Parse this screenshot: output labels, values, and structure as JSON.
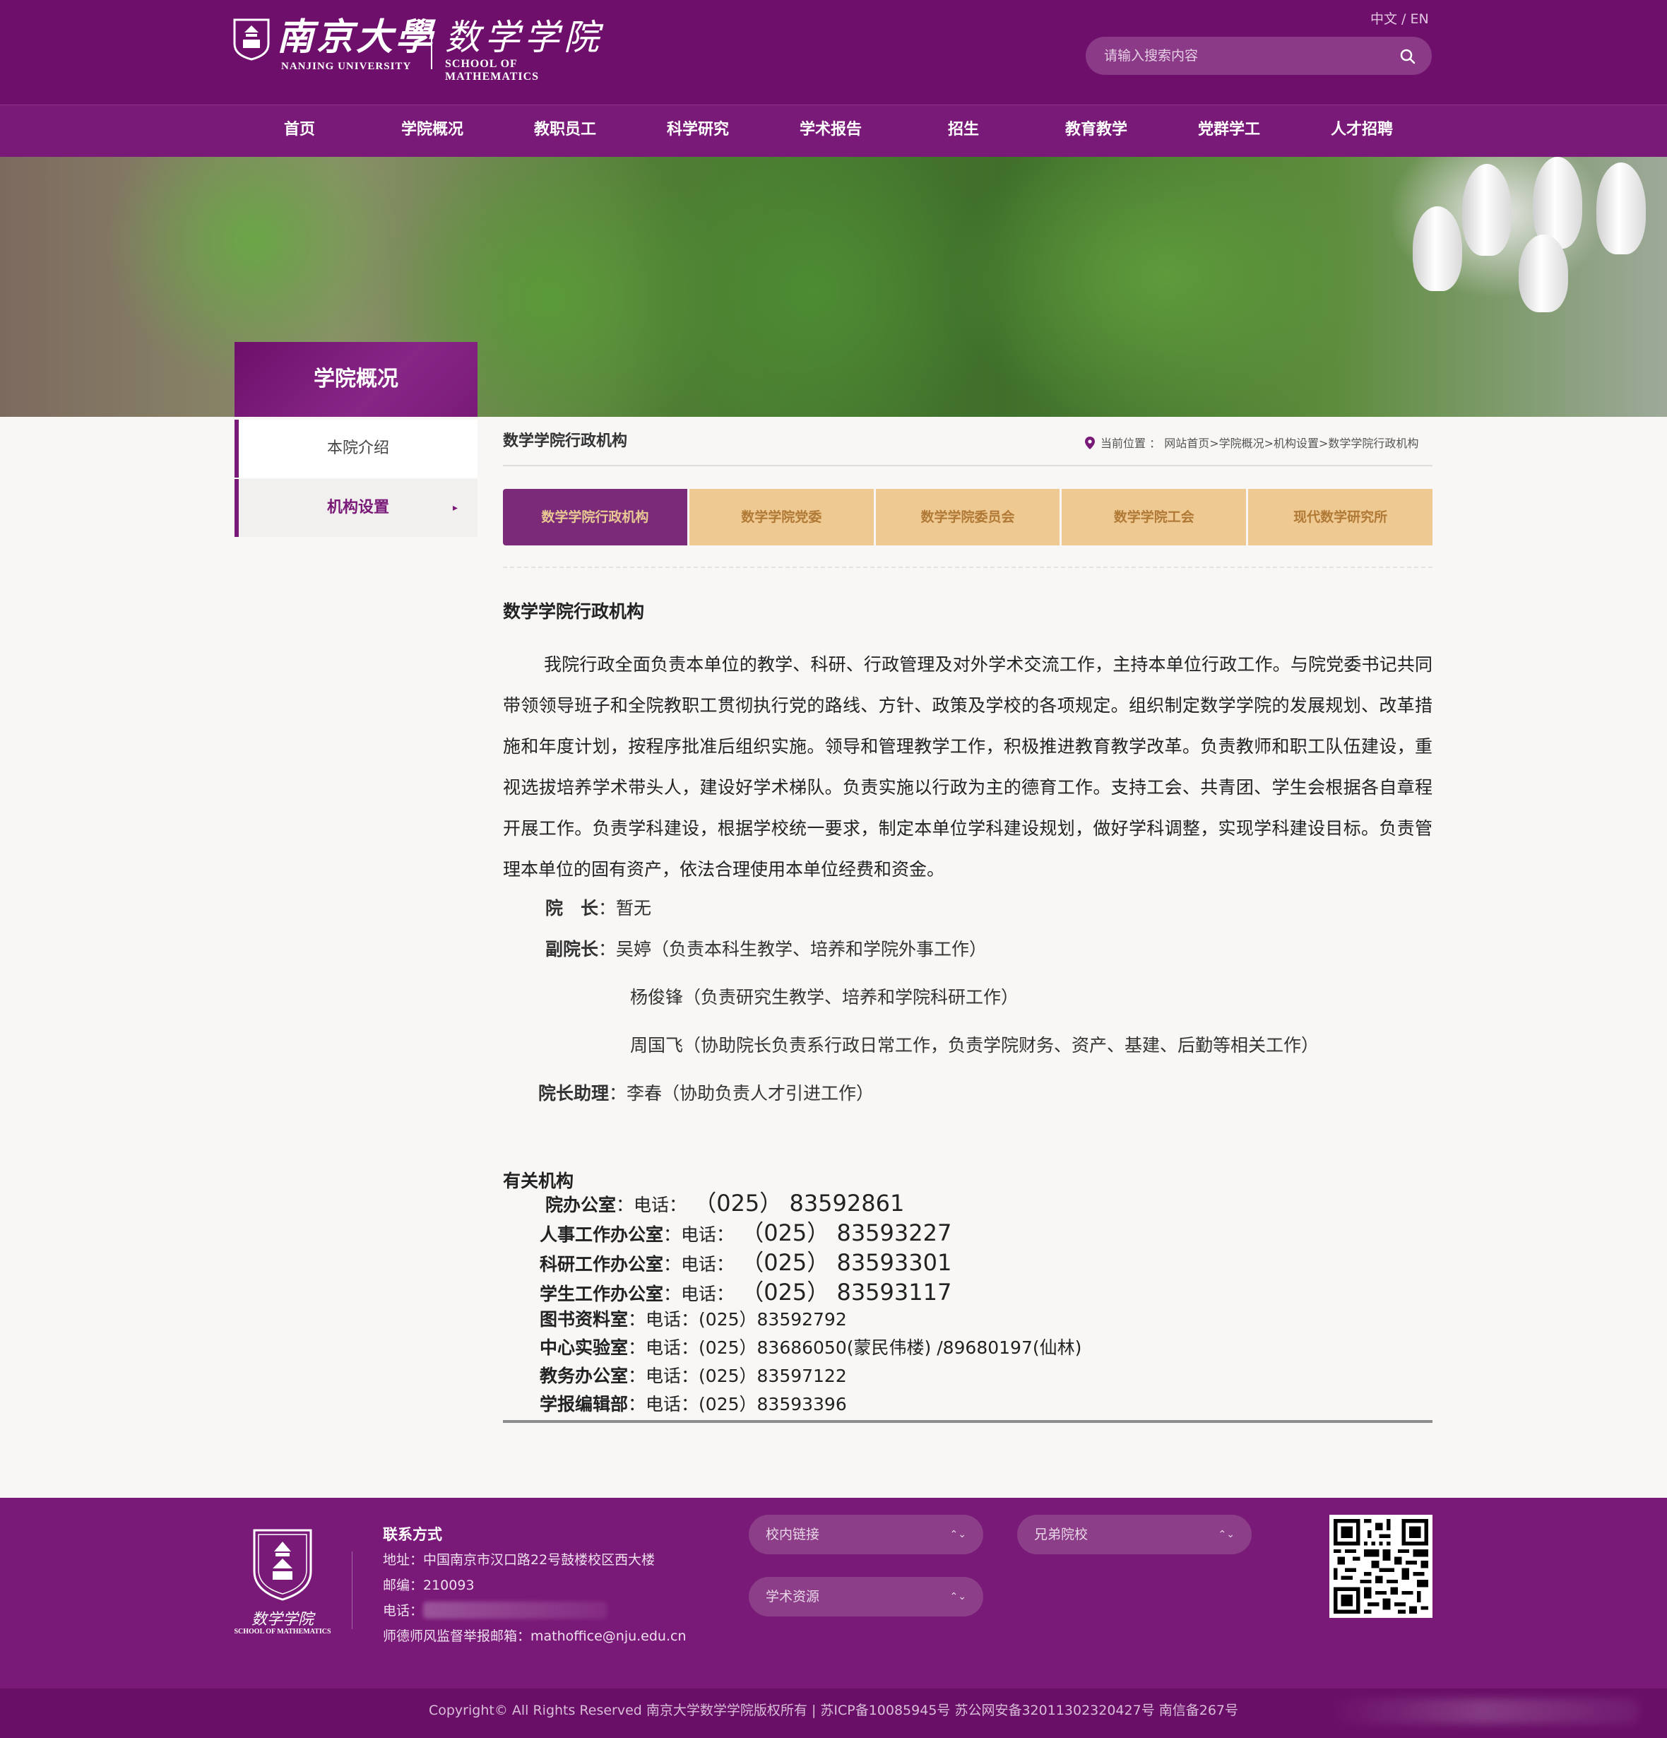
{
  "header": {
    "logo": {
      "nju_cn": "南京大學",
      "nju_en": "NANJING UNIVERSITY",
      "school_cn": "数学学院",
      "school_en": "SCHOOL OF MATHEMATICS"
    },
    "lang": {
      "cn": "中文",
      "sep": " / ",
      "en": "EN"
    },
    "search": {
      "placeholder": "请输入搜索内容",
      "icon": "search-icon"
    }
  },
  "nav": [
    "首页",
    "学院概况",
    "教职员工",
    "科学研究",
    "学术报告",
    "招生",
    "教育教学",
    "党群学工",
    "人才招聘"
  ],
  "sidebar": {
    "title": "学院概况",
    "items": [
      {
        "label": "本院介绍"
      },
      {
        "label": "机构设置",
        "arrow": "▸"
      }
    ]
  },
  "main": {
    "title": "数学学院行政机构",
    "breadcrumb": {
      "prefix": "当前位置 ：",
      "path": "网站首页>学院概况>机构设置>数学学院行政机构"
    },
    "tabs": [
      "数学学院行政机构",
      "数学学院党委",
      "数学学院委员会",
      "数学学院工会",
      "现代数学研究所"
    ],
    "content": {
      "heading": "数学学院行政机构",
      "paragraph": "我院行政全面负责本单位的教学、科研、行政管理及对外学术交流工作，主持本单位行政工作。与院党委书记共同带领领导班子和全院教职工贯彻执行党的路线、方针、政策及学校的各项规定。组织制定数学学院的发展规划、改革措施和年度计划，按程序批准后组织实施。领导和管理教学工作，积极推进教育教学改革。负责教师和职工队伍建设，重视选拔培养学术带头人，建设好学术梯队。负责实施以行政为主的德育工作。支持工会、共青团、学生会根据各自章程开展工作。负责学科建设，根据学校统一要求，制定本单位学科建设规划，做好学科调整，实现学科建设目标。负责管理本单位的固有资产，依法合理使用本单位经费和资金。",
      "dean_label": "院　长",
      "dean_value": "：暂无",
      "vice_label": "副院长",
      "vice_1": "：吴婷（负责本科生教学、培养和学院外事工作）",
      "vice_2": "杨俊锋（负责研究生教学、培养和学院科研工作）",
      "vice_3": "周国飞（协助院长负责系行政日常工作，负责学院财务、资产、基建、后勤等相关工作）",
      "assistant_label": "院长助理",
      "assistant_value": "：李春（协助负责人才引进工作）"
    },
    "related": {
      "heading": "有关机构",
      "items": [
        {
          "name": "院办公室",
          "tel_label": "：电话：",
          "tel": " （025） 83592861"
        },
        {
          "name": "人事工作办公室",
          "tel_label": "：电话：",
          "tel": " （025） 83593227"
        },
        {
          "name": "科研工作办公室",
          "tel_label": "：电话：",
          "tel": " （025） 83593301"
        },
        {
          "name": "学生工作办公室",
          "tel_label": "：电话：",
          "tel": " （025） 83593117"
        },
        {
          "name": "图书资料室",
          "tel_label": "：电话：",
          "tel": "(025）83592792"
        },
        {
          "name": "中心实验室",
          "tel_label": "：电话：",
          "tel": "(025）83686050(蒙民伟楼) /89680197(仙林)"
        },
        {
          "name": "教务办公室",
          "tel_label": "：电话：",
          "tel": "(025）83597122"
        },
        {
          "name": "学报编辑部",
          "tel_label": "：电话：",
          "tel": "(025）83593396"
        }
      ]
    }
  },
  "footer": {
    "logo_cn": "数学学院",
    "logo_en": "SCHOOL OF MATHEMATICS",
    "contact": {
      "heading": "联系方式",
      "address": "地址：中国南京市汉口路22号鼓楼校区西大楼",
      "postcode": "邮编：210093",
      "phone_label": "电话：",
      "email": "师德师风监督举报邮箱：mathoffice@nju.edu.cn"
    },
    "selects": [
      "校内链接",
      "兄弟院校",
      "学术资源"
    ],
    "copyright": "Copyright© All Rights Reserved 南京大学数学学院版权所有 | 苏ICP备10085945号 苏公网安备32011302320427号 南信备267号"
  },
  "colors": {
    "primary": "#7a1a78",
    "header_bg": "#6e0f6c",
    "tab_inactive": "#efc992",
    "tab_active": "#7b2a79"
  }
}
